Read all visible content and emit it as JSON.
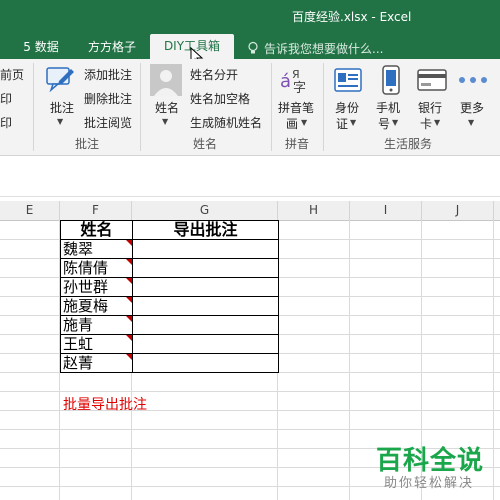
{
  "window": {
    "title": "百度经验.xlsx - Excel"
  },
  "tabs": [
    {
      "label": "5 数据"
    },
    {
      "label": "方方格子"
    },
    {
      "label": "DIY工具箱",
      "active": true
    }
  ],
  "tell_me": {
    "text": "告诉我您想要做什么..."
  },
  "ribbon": {
    "partial": [
      "前页",
      "印",
      "印"
    ],
    "comment_group": {
      "label": "批注",
      "big_button": "批注",
      "items": [
        "添加批注",
        "删除批注",
        "批注阅览"
      ]
    },
    "name_group": {
      "label": "姓名",
      "big_button": "姓名",
      "items": [
        "姓名分开",
        "姓名加空格",
        "生成随机姓名"
      ]
    },
    "pinyin_group": {
      "label": "拼音",
      "big_button_line1": "拼音笔",
      "big_button_line2": "画"
    },
    "life_group": {
      "label": "生活服务",
      "buttons": [
        {
          "line1": "身份",
          "line2": "证"
        },
        {
          "line1": "手机",
          "line2": "号"
        },
        {
          "line1": "银行",
          "line2": "卡"
        },
        {
          "line1": "更多",
          "line2": ""
        }
      ]
    }
  },
  "grid": {
    "columns": [
      "E",
      "F",
      "G",
      "H",
      "I",
      "J"
    ],
    "table_headers": [
      "姓名",
      "导出批注"
    ],
    "names": [
      "魏翠",
      "陈倩倩",
      "孙世群",
      "施夏梅",
      "施青",
      "王虹",
      "赵菁"
    ],
    "note": "批量导出批注"
  },
  "watermark": {
    "line1": "百科全说",
    "line2": "助你轻松解决"
  },
  "colors": {
    "excel_green": "#217346",
    "comment_marker": "#c00000",
    "note_red": "#e00000",
    "watermark_green": "#1aa64a"
  }
}
